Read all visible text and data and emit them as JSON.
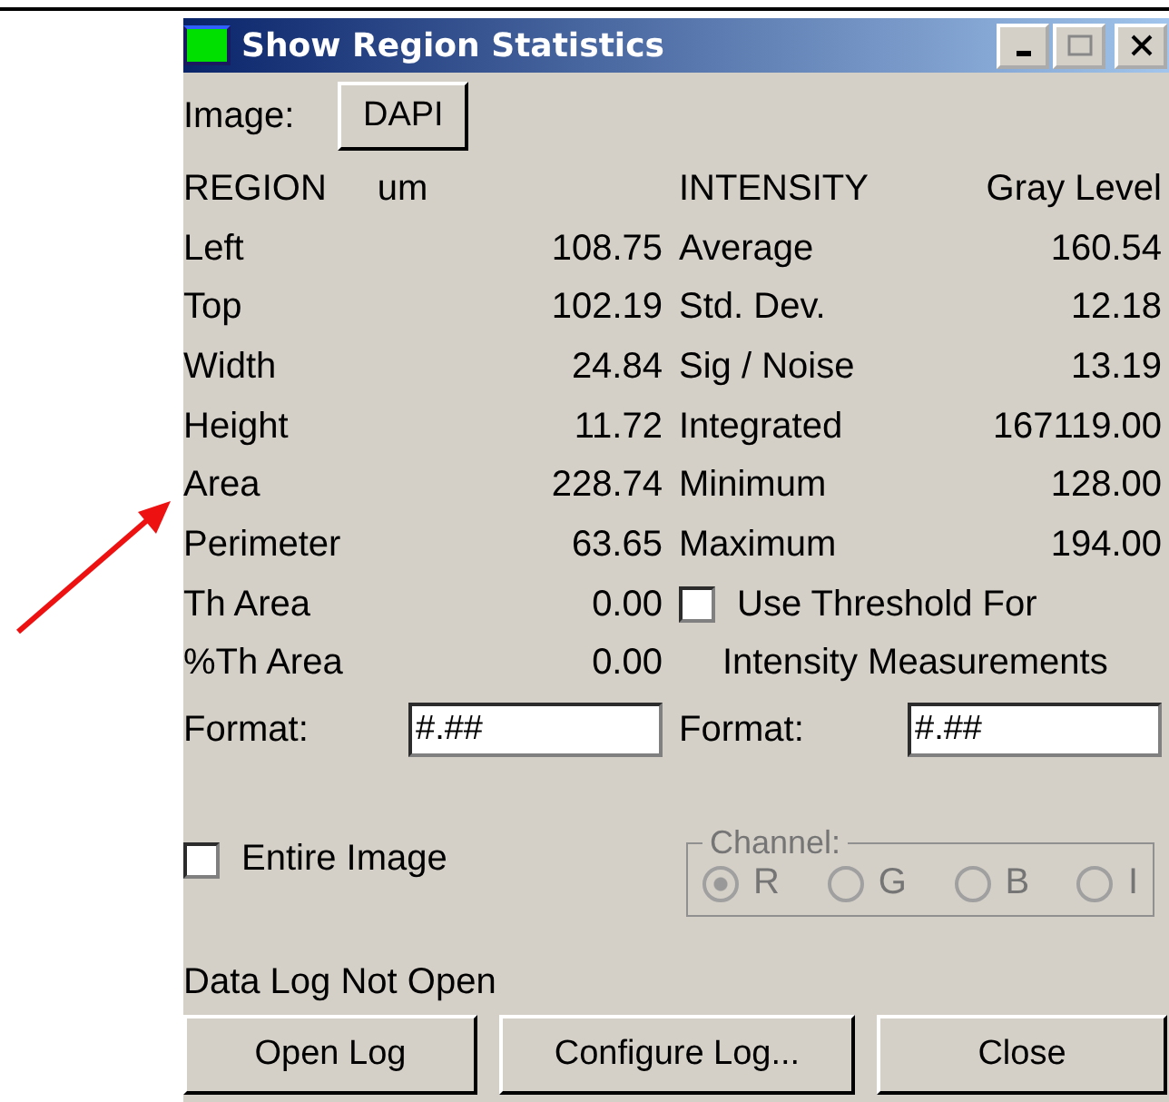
{
  "window": {
    "title": "Show Region Statistics"
  },
  "image": {
    "label": "Image:",
    "button": "DAPI"
  },
  "region": {
    "heading": "REGION",
    "unit": "um",
    "rows": [
      {
        "label": "Left",
        "value": "108.75"
      },
      {
        "label": "Top",
        "value": "102.19"
      },
      {
        "label": "Width",
        "value": "24.84"
      },
      {
        "label": "Height",
        "value": "11.72"
      },
      {
        "label": "Area",
        "value": "228.74"
      },
      {
        "label": "Perimeter",
        "value": "63.65"
      },
      {
        "label": "Th Area",
        "value": "0.00"
      },
      {
        "label": "%Th Area",
        "value": "0.00"
      }
    ]
  },
  "intensity": {
    "heading": "INTENSITY",
    "unit": "Gray Level",
    "rows": [
      {
        "label": "Average",
        "value": "160.54"
      },
      {
        "label": "Std. Dev.",
        "value": "12.18"
      },
      {
        "label": "Sig / Noise",
        "value": "13.19"
      },
      {
        "label": "Integrated",
        "value": "167119.00"
      },
      {
        "label": "Minimum",
        "value": "128.00"
      },
      {
        "label": "Maximum",
        "value": "194.00"
      }
    ]
  },
  "threshold": {
    "line1": "Use Threshold For",
    "line2": "Intensity Measurements",
    "checked": false
  },
  "format_region": {
    "label": "Format:",
    "value": "#.##"
  },
  "format_intensity": {
    "label": "Format:",
    "value": "#.##"
  },
  "entire_image": {
    "label": "Entire Image",
    "checked": false
  },
  "channel": {
    "label": "Channel:",
    "disabled": true,
    "options": [
      {
        "label": "R",
        "selected": true
      },
      {
        "label": "G",
        "selected": false
      },
      {
        "label": "B",
        "selected": false
      },
      {
        "label": "I",
        "selected": false
      }
    ]
  },
  "status": "Data Log Not Open",
  "buttons": [
    "Open Log",
    "Configure Log...",
    "Close"
  ]
}
